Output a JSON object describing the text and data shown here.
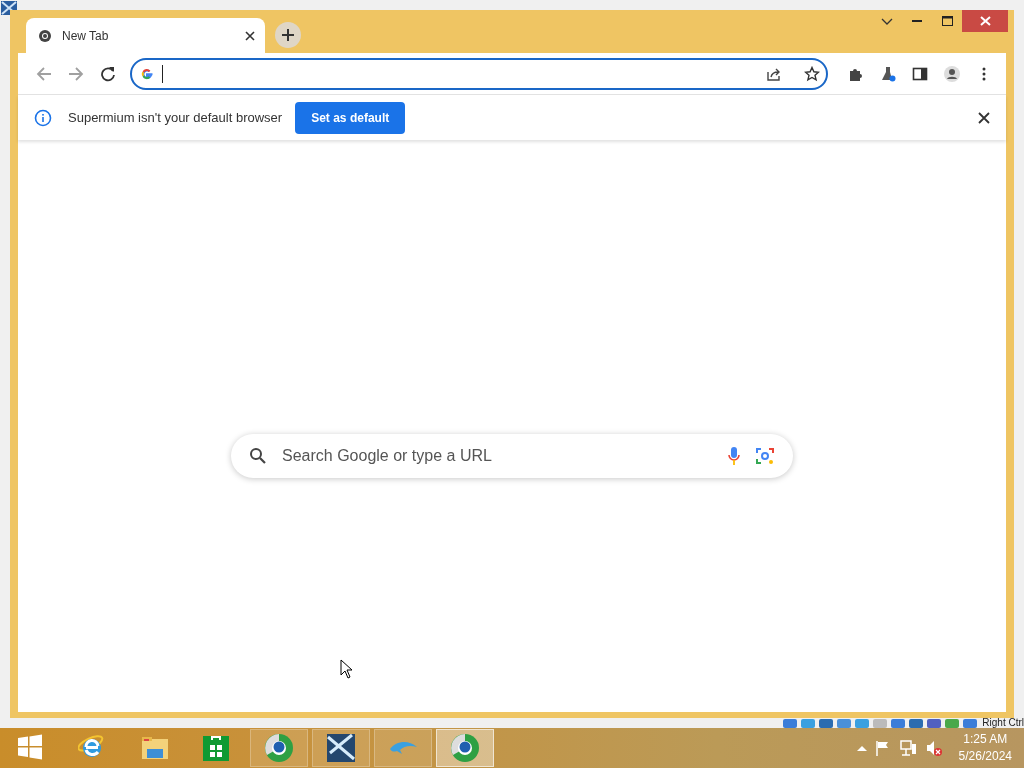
{
  "browser": {
    "tabs": [
      {
        "title": "New Tab",
        "selected": true
      }
    ],
    "back": {
      "disabled": true
    },
    "forward": {
      "disabled": true
    },
    "infobar": {
      "message": "Supermium isn't your default browser",
      "button": "Set as default"
    },
    "ntp_search": {
      "placeholder": "Search Google or type a URL"
    }
  },
  "vm_status_bar": {
    "host_key": "Right Ctrl"
  },
  "taskbar": {
    "apps": [
      {
        "kind": "start"
      },
      {
        "kind": "ie"
      },
      {
        "kind": "explorer"
      },
      {
        "kind": "store"
      },
      {
        "kind": "chromium",
        "selected": false
      },
      {
        "kind": "vista",
        "selected": false
      },
      {
        "kind": "dolphin",
        "selected": false
      },
      {
        "kind": "chromium",
        "selected": true
      }
    ],
    "clock": {
      "time": "1:25 AM",
      "date": "5/26/2024"
    }
  }
}
